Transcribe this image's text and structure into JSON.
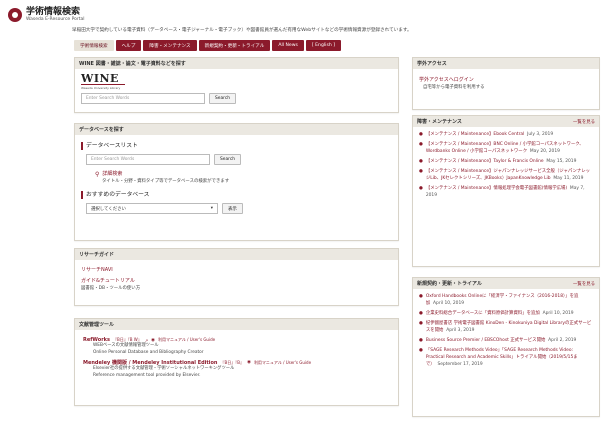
{
  "header": {
    "title": "学術情報検索",
    "subtitle": "Waseda E-Resource Portal",
    "description": "早稲田大学で契約している電子資料（データベース・電子ジャーナル・電子ブック）や図書館員が選んだ有用なWebサイトなどの学術情報資源が登録されています。"
  },
  "tabs": [
    {
      "label": "学術情報検索",
      "active": true
    },
    {
      "label": "ヘルプ"
    },
    {
      "label": "障害・メンテナンス"
    },
    {
      "label": "新規契約・更新・トライアル"
    },
    {
      "label": "All News"
    },
    {
      "label": "[ English ]"
    }
  ],
  "wine": {
    "heading": "WINE 図書・雑誌・論文・電子資料などを探す",
    "logo": "WINE",
    "logo_sub": "Waseda University Library",
    "placeholder": "Enter Search Words",
    "button": "Search"
  },
  "db": {
    "heading": "データベースを探す",
    "list_title": "データベースリスト",
    "placeholder": "Enter Search Words",
    "button": "Search",
    "advanced_link": "詳細検索",
    "advanced_desc": "タイトル・分野・資料タイプ等でデータベースの検索ができます",
    "recommend_title": "おすすめのデータベース",
    "select_value": "選択してください",
    "display_button": "表示"
  },
  "guide": {
    "heading": "リサーチガイド",
    "navi": "リサーチNAVI",
    "tutorial": "ガイド&チュートリアル",
    "tutorial_desc": "図書館・DB・ツールの使い方"
  },
  "tools": {
    "heading": "文献管理ツール",
    "refworks_name": "RefWorks",
    "refworks_tags": "『B日』『B W』",
    "refworks_manual": "利用マニュアル / User's Guide",
    "refworks_desc1": "WEBベースの文献情報管理ツール",
    "refworks_desc2": "Online Personal Database and Bibliography Creator",
    "mendeley_name": "Mendeley 機関版 / Mendeley Institutional Edition",
    "mendeley_tags": "『B日』『B』",
    "mendeley_manual": "利用マニュアル / User's Guide",
    "mendeley_desc1": "Elsevier社の提供する文献管理・学術ソーシャルネットワーキングツール",
    "mendeley_desc2": "Reference management tool provided by Elsevier."
  },
  "access": {
    "heading": "学外アクセス",
    "link": "学外アクセスへログイン",
    "desc": "自宅等から電子資料を利用する"
  },
  "maintenance": {
    "heading": "障害・メンテナンス",
    "more": "一覧を見る",
    "items": [
      {
        "title": "【メンテナンス / Maintenance】Ebook Central",
        "date": "July 3, 2019"
      },
      {
        "title": "【メンテナンス / Maintenance】BNC Online / 小学館コーパスネットワーク、Wordbanks Online / 小学館コーパスネットワーク",
        "date": "May 20, 2019"
      },
      {
        "title": "【メンテナンス / Maintenance】Taylor & Francis Online",
        "date": "May 15, 2019"
      },
      {
        "title": "【メンテナンス / Maintenance】ジャパンナレッジサービス全般（ジャパンナレッジLib、JKセレクトシリーズ、JKBooks）JapanKnowledge Lib",
        "date": "May 11, 2019"
      },
      {
        "title": "【メンテナンス / Maintenance】情報処理学会電子図書館(情報学広場)",
        "date": "May 7, 2019"
      }
    ]
  },
  "trial": {
    "heading": "新規契約・更新・トライアル",
    "more": "一覧を見る",
    "items": [
      {
        "title": "Oxford Handbooks Onlineに「経済学・ファイナンス（2016-2018）」を追加",
        "date": "April 10, 2019"
      },
      {
        "title": "企業史料総合データベースに「資料原価計算資料」を追加",
        "date": "April 10, 2019"
      },
      {
        "title": "紀伊國屋書店 学術電子図書館 KinoDen - Kinokuniya Digital Libraryの正式サービスを開始",
        "date": "April 3, 2019"
      },
      {
        "title": "Business Source Premier / EBSCOhost 正式サービス開始",
        "date": "April 2, 2019"
      },
      {
        "title": "「SAGE Research Methods Video」「SAGE Research Methods Video: Practical Research and Academic Skills」トライアル開始（2019/5/15まで）",
        "date": "September 17, 2019"
      }
    ]
  }
}
